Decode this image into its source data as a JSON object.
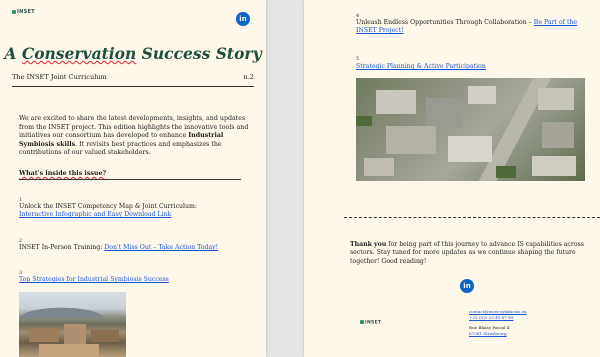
{
  "left_page": {
    "logo": "INSET",
    "linkedin_icon_label": "in",
    "title_prefix": "A ",
    "title_highlight": "Conservation",
    "title_suffix": " Success Story",
    "curriculum_label": "The INSET Joint Curriculum",
    "issue_number": "n.2",
    "intro_1": "We are excited to share the latest developments, insights, and updates from the INSET project. This edition highlights the innovative tools and initiatives our consortium has developed to enhance ",
    "intro_bold": "Industrial Symbiosis skills",
    "intro_2": ". It revisits best practices and emphasizes the contributions of our valued stakeholders.",
    "inside_heading": "What's inside this issue?",
    "items": [
      {
        "number": "1",
        "text": "Unlock the INSET Competency Map & Joint Curriculum: ",
        "link": "Interactive Infographic and Easy Download Link"
      },
      {
        "number": "2",
        "text": "INSET In-Person Training: ",
        "link": "Don't Miss Out – Take Action Today!"
      },
      {
        "number": "3",
        "text": "",
        "link": "Top Strategies for Industrial Symbiosis Success"
      }
    ]
  },
  "right_page": {
    "items": [
      {
        "number": "4",
        "text": "Unleash Endless Opportunities Through Collaboration – ",
        "link": "Be Part of the INSET Project!"
      },
      {
        "number": "5",
        "text": "",
        "link": "Strategic Planning & Active Participation"
      }
    ],
    "thanks_bold": "Thank you",
    "thanks_rest": " for being part of this journey to advance IS capabilities across sectors. Stay tuned for more updates as we continue shaping the future together! Good reading!",
    "linkedin_icon_label": "in",
    "footer_logo": "INSET",
    "contact_email": "contact@inset-symbiosis.eu",
    "contact_phone": "+33 (0)3 23 45 67 89",
    "address_line1": "Rue Blaise Pascal 4",
    "address_line2": "67081 Strasbourg"
  },
  "colors": {
    "page": "#fef8ea",
    "title": "#1f4d3f",
    "link": "#1a57d6",
    "linkedin": "#0a66c2"
  },
  "icons": [
    "inset-logo-icon",
    "linkedin-icon",
    "factory-photo",
    "aerial-photo"
  ]
}
